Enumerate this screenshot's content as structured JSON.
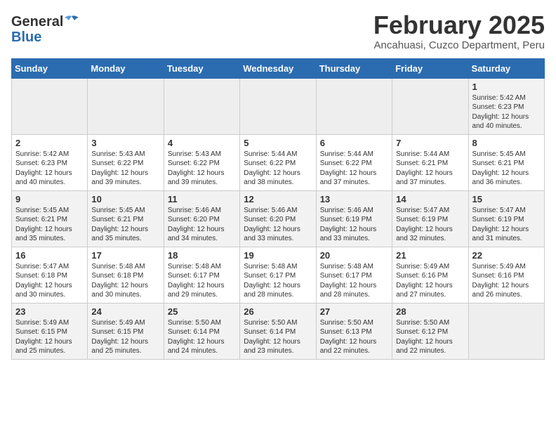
{
  "header": {
    "logo_general": "General",
    "logo_blue": "Blue",
    "title": "February 2025",
    "subtitle": "Ancahuasi, Cuzco Department, Peru"
  },
  "weekdays": [
    "Sunday",
    "Monday",
    "Tuesday",
    "Wednesday",
    "Thursday",
    "Friday",
    "Saturday"
  ],
  "weeks": [
    [
      {
        "day": "",
        "text": ""
      },
      {
        "day": "",
        "text": ""
      },
      {
        "day": "",
        "text": ""
      },
      {
        "day": "",
        "text": ""
      },
      {
        "day": "",
        "text": ""
      },
      {
        "day": "",
        "text": ""
      },
      {
        "day": "1",
        "text": "Sunrise: 5:42 AM\nSunset: 6:23 PM\nDaylight: 12 hours\nand 40 minutes."
      }
    ],
    [
      {
        "day": "2",
        "text": "Sunrise: 5:42 AM\nSunset: 6:23 PM\nDaylight: 12 hours\nand 40 minutes."
      },
      {
        "day": "3",
        "text": "Sunrise: 5:43 AM\nSunset: 6:22 PM\nDaylight: 12 hours\nand 39 minutes."
      },
      {
        "day": "4",
        "text": "Sunrise: 5:43 AM\nSunset: 6:22 PM\nDaylight: 12 hours\nand 39 minutes."
      },
      {
        "day": "5",
        "text": "Sunrise: 5:44 AM\nSunset: 6:22 PM\nDaylight: 12 hours\nand 38 minutes."
      },
      {
        "day": "6",
        "text": "Sunrise: 5:44 AM\nSunset: 6:22 PM\nDaylight: 12 hours\nand 37 minutes."
      },
      {
        "day": "7",
        "text": "Sunrise: 5:44 AM\nSunset: 6:21 PM\nDaylight: 12 hours\nand 37 minutes."
      },
      {
        "day": "8",
        "text": "Sunrise: 5:45 AM\nSunset: 6:21 PM\nDaylight: 12 hours\nand 36 minutes."
      }
    ],
    [
      {
        "day": "9",
        "text": "Sunrise: 5:45 AM\nSunset: 6:21 PM\nDaylight: 12 hours\nand 35 minutes."
      },
      {
        "day": "10",
        "text": "Sunrise: 5:45 AM\nSunset: 6:21 PM\nDaylight: 12 hours\nand 35 minutes."
      },
      {
        "day": "11",
        "text": "Sunrise: 5:46 AM\nSunset: 6:20 PM\nDaylight: 12 hours\nand 34 minutes."
      },
      {
        "day": "12",
        "text": "Sunrise: 5:46 AM\nSunset: 6:20 PM\nDaylight: 12 hours\nand 33 minutes."
      },
      {
        "day": "13",
        "text": "Sunrise: 5:46 AM\nSunset: 6:19 PM\nDaylight: 12 hours\nand 33 minutes."
      },
      {
        "day": "14",
        "text": "Sunrise: 5:47 AM\nSunset: 6:19 PM\nDaylight: 12 hours\nand 32 minutes."
      },
      {
        "day": "15",
        "text": "Sunrise: 5:47 AM\nSunset: 6:19 PM\nDaylight: 12 hours\nand 31 minutes."
      }
    ],
    [
      {
        "day": "16",
        "text": "Sunrise: 5:47 AM\nSunset: 6:18 PM\nDaylight: 12 hours\nand 30 minutes."
      },
      {
        "day": "17",
        "text": "Sunrise: 5:48 AM\nSunset: 6:18 PM\nDaylight: 12 hours\nand 30 minutes."
      },
      {
        "day": "18",
        "text": "Sunrise: 5:48 AM\nSunset: 6:17 PM\nDaylight: 12 hours\nand 29 minutes."
      },
      {
        "day": "19",
        "text": "Sunrise: 5:48 AM\nSunset: 6:17 PM\nDaylight: 12 hours\nand 28 minutes."
      },
      {
        "day": "20",
        "text": "Sunrise: 5:48 AM\nSunset: 6:17 PM\nDaylight: 12 hours\nand 28 minutes."
      },
      {
        "day": "21",
        "text": "Sunrise: 5:49 AM\nSunset: 6:16 PM\nDaylight: 12 hours\nand 27 minutes."
      },
      {
        "day": "22",
        "text": "Sunrise: 5:49 AM\nSunset: 6:16 PM\nDaylight: 12 hours\nand 26 minutes."
      }
    ],
    [
      {
        "day": "23",
        "text": "Sunrise: 5:49 AM\nSunset: 6:15 PM\nDaylight: 12 hours\nand 25 minutes."
      },
      {
        "day": "24",
        "text": "Sunrise: 5:49 AM\nSunset: 6:15 PM\nDaylight: 12 hours\nand 25 minutes."
      },
      {
        "day": "25",
        "text": "Sunrise: 5:50 AM\nSunset: 6:14 PM\nDaylight: 12 hours\nand 24 minutes."
      },
      {
        "day": "26",
        "text": "Sunrise: 5:50 AM\nSunset: 6:14 PM\nDaylight: 12 hours\nand 23 minutes."
      },
      {
        "day": "27",
        "text": "Sunrise: 5:50 AM\nSunset: 6:13 PM\nDaylight: 12 hours\nand 22 minutes."
      },
      {
        "day": "28",
        "text": "Sunrise: 5:50 AM\nSunset: 6:12 PM\nDaylight: 12 hours\nand 22 minutes."
      },
      {
        "day": "",
        "text": ""
      }
    ]
  ]
}
